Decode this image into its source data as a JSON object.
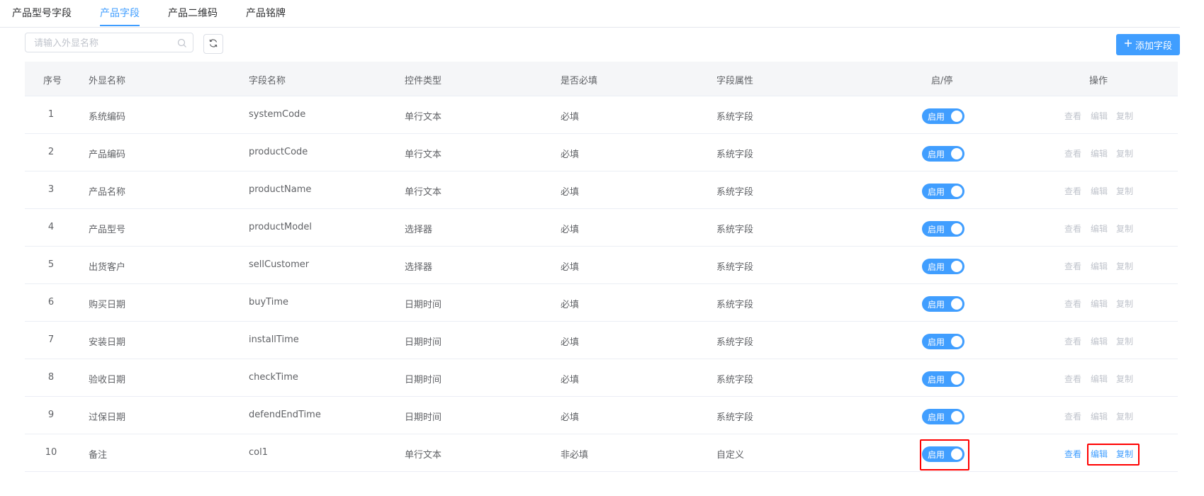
{
  "tabs": [
    {
      "label": "产品型号字段",
      "active": false
    },
    {
      "label": "产品字段",
      "active": true
    },
    {
      "label": "产品二维码",
      "active": false
    },
    {
      "label": "产品铭牌",
      "active": false
    }
  ],
  "search": {
    "placeholder": "请输入外显名称"
  },
  "toolbar": {
    "add_label": "添加字段"
  },
  "colors": {
    "accent": "#409eff",
    "highlight": "#ff0000",
    "disabled": "#c0c4cc"
  },
  "table": {
    "headers": [
      "序号",
      "外显名称",
      "字段名称",
      "控件类型",
      "是否必填",
      "字段属性",
      "启/停",
      "操作"
    ],
    "rows": [
      {
        "index": "1",
        "display": "系统编码",
        "field": "systemCode",
        "control": "单行文本",
        "required": "必填",
        "attr": "系统字段",
        "status": "启用",
        "ops_enabled": false
      },
      {
        "index": "2",
        "display": "产品编码",
        "field": "productCode",
        "control": "单行文本",
        "required": "必填",
        "attr": "系统字段",
        "status": "启用",
        "ops_enabled": false
      },
      {
        "index": "3",
        "display": "产品名称",
        "field": "productName",
        "control": "单行文本",
        "required": "必填",
        "attr": "系统字段",
        "status": "启用",
        "ops_enabled": false
      },
      {
        "index": "4",
        "display": "产品型号",
        "field": "productModel",
        "control": "选择器",
        "required": "必填",
        "attr": "系统字段",
        "status": "启用",
        "ops_enabled": false
      },
      {
        "index": "5",
        "display": "出货客户",
        "field": "sellCustomer",
        "control": "选择器",
        "required": "必填",
        "attr": "系统字段",
        "status": "启用",
        "ops_enabled": false
      },
      {
        "index": "6",
        "display": "购买日期",
        "field": "buyTime",
        "control": "日期时间",
        "required": "必填",
        "attr": "系统字段",
        "status": "启用",
        "ops_enabled": false
      },
      {
        "index": "7",
        "display": "安装日期",
        "field": "installTime",
        "control": "日期时间",
        "required": "必填",
        "attr": "系统字段",
        "status": "启用",
        "ops_enabled": false
      },
      {
        "index": "8",
        "display": "验收日期",
        "field": "checkTime",
        "control": "日期时间",
        "required": "必填",
        "attr": "系统字段",
        "status": "启用",
        "ops_enabled": false
      },
      {
        "index": "9",
        "display": "过保日期",
        "field": "defendEndTime",
        "control": "日期时间",
        "required": "必填",
        "attr": "系统字段",
        "status": "启用",
        "ops_enabled": false
      },
      {
        "index": "10",
        "display": "备注",
        "field": "col1",
        "control": "单行文本",
        "required": "非必填",
        "attr": "自定义",
        "status": "启用",
        "ops_enabled": true
      }
    ],
    "actions": [
      "查看",
      "编辑",
      "复制"
    ]
  }
}
